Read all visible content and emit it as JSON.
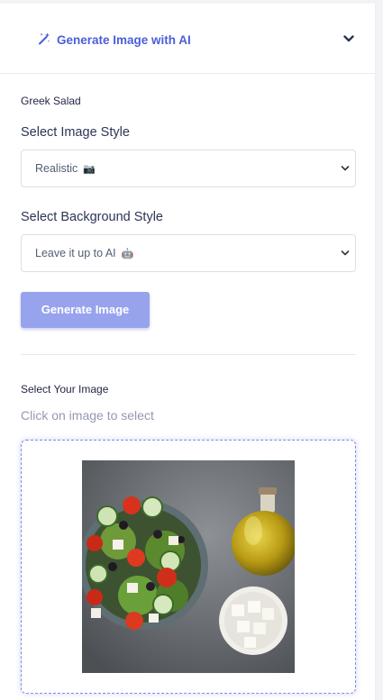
{
  "header": {
    "title": "Generate Image with AI",
    "icon": "magic-wand-icon",
    "toggle_icon": "chevron-down-icon"
  },
  "product": {
    "name": "Greek Salad"
  },
  "image_style": {
    "label": "Select Image Style",
    "value": "Realistic",
    "emoji": "📷"
  },
  "background_style": {
    "label": "Select Background Style",
    "value": "Leave it up to AI",
    "emoji": "🤖"
  },
  "generate_button": {
    "label": "Generate Image"
  },
  "select_image": {
    "title": "Select Your Image",
    "hint": "Click on image to select"
  },
  "colors": {
    "accent": "#4c5ed8",
    "button": "#98a3ee",
    "border_dashed": "#7f89e8"
  }
}
